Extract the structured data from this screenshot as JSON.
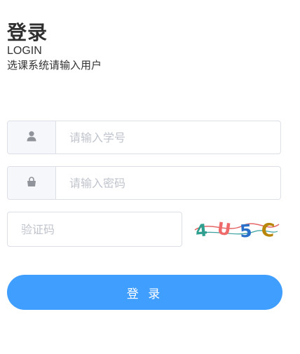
{
  "header": {
    "title": "登录",
    "subtitle": "LOGIN",
    "description": "选课系统请输入用户"
  },
  "form": {
    "student_id_placeholder": "请输入学号",
    "password_placeholder": "请输入密码",
    "captcha_placeholder": "验证码",
    "captcha_text": "4U5C",
    "submit_label": "登 录"
  },
  "icons": {
    "user": "user-icon",
    "lock": "lock-icon"
  },
  "colors": {
    "primary": "#409eff",
    "border": "#dcdfe6",
    "prefix_bg": "#f5f7fa",
    "placeholder": "#c0c4cc",
    "icon": "#909399"
  }
}
